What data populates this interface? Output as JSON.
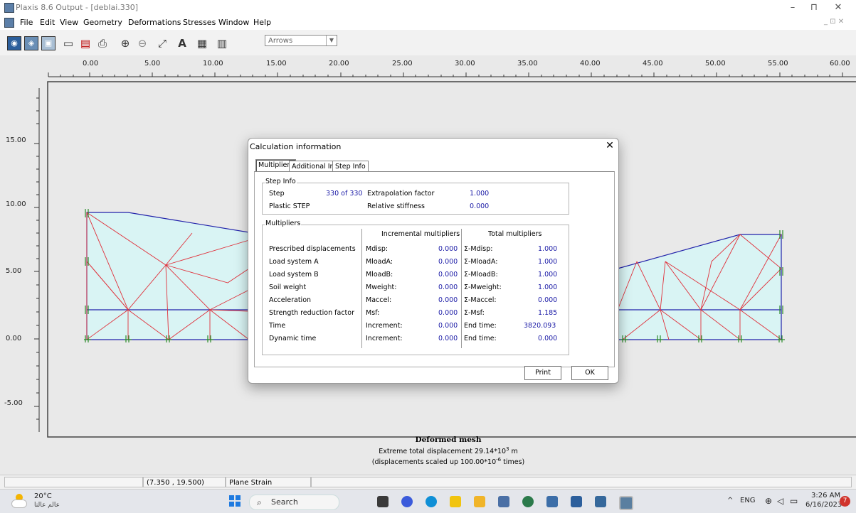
{
  "window": {
    "title": "Plaxis 8.6 Output - [deblai.330]",
    "controls": [
      "–",
      "⊓",
      "✕"
    ],
    "mdi_controls": "_ ⊡ ✕"
  },
  "menu": [
    "File",
    "Edit",
    "View",
    "Geometry",
    "Deformations",
    "Stresses",
    "Window",
    "Help"
  ],
  "toolbar": {
    "select_value": "Arrows",
    "icons": [
      "plaxis-logo-icon",
      "output-icon",
      "input-icon",
      "open-folder-icon",
      "print-preview-icon",
      "print-icon",
      "zoom-in-icon",
      "zoom-out-icon",
      "relocate-icon",
      "annotate-icon",
      "table-icon",
      "clipboard-icon"
    ]
  },
  "ruler": {
    "top_labels": [
      "0.00",
      "5.00",
      "10.00",
      "15.00",
      "20.00",
      "25.00",
      "30.00",
      "35.00",
      "40.00",
      "45.00",
      "50.00",
      "55.00",
      "60.00"
    ],
    "left_labels": [
      "15.00",
      "10.00",
      "5.00",
      "0.00",
      "-5.00"
    ]
  },
  "dialog": {
    "title": "Calculation information",
    "close": "✕",
    "tabs": [
      "Multipliers",
      "Additional Info",
      "Step Info"
    ],
    "step_info": {
      "group_label": "Step Info",
      "step_label": "Step",
      "step_value": "330 of 330",
      "extrapolation_label": "Extrapolation factor",
      "extrapolation_value": "1.000",
      "plastic_label": "Plastic STEP",
      "relative_stiffness_label": "Relative stiffness",
      "relative_stiffness_value": "0.000"
    },
    "multipliers": {
      "group_label": "Multipliers",
      "incremental_header": "Incremental multipliers",
      "total_header": "Total multipliers",
      "rows": [
        {
          "name": "Prescribed displacements",
          "inc_key": "Mdisp:",
          "inc_val": "0.000",
          "tot_key": "Σ-Mdisp:",
          "tot_val": "1.000"
        },
        {
          "name": "Load system A",
          "inc_key": "MloadA:",
          "inc_val": "0.000",
          "tot_key": "Σ-MloadA:",
          "tot_val": "1.000"
        },
        {
          "name": "Load system B",
          "inc_key": "MloadB:",
          "inc_val": "0.000",
          "tot_key": "Σ-MloadB:",
          "tot_val": "1.000"
        },
        {
          "name": "Soil weight",
          "inc_key": "Mweight:",
          "inc_val": "0.000",
          "tot_key": "Σ-Mweight:",
          "tot_val": "1.000"
        },
        {
          "name": "Acceleration",
          "inc_key": "Maccel:",
          "inc_val": "0.000",
          "tot_key": "Σ-Maccel:",
          "tot_val": "0.000"
        },
        {
          "name": "Strength reduction factor",
          "inc_key": "Msf:",
          "inc_val": "0.000",
          "tot_key": "Σ-Msf:",
          "tot_val": "1.185"
        },
        {
          "name": "Time",
          "inc_key": "Increment:",
          "inc_val": "0.000",
          "tot_key": "End time:",
          "tot_val": "3820.093"
        },
        {
          "name": "Dynamic time",
          "inc_key": "Increment:",
          "inc_val": "0.000",
          "tot_key": "End time:",
          "tot_val": "0.000"
        }
      ]
    },
    "print_label": "Print",
    "ok_label": "OK"
  },
  "caption": {
    "title": "Deformed mesh",
    "line1_pre": "Extreme total displacement 29.14*10",
    "line1_exp": "3",
    "line1_post": " m",
    "line2_pre": "(displacements scaled up 100.00*10",
    "line2_exp": "-6",
    "line2_post": " times)"
  },
  "statusbar": {
    "coords": "(7.350 , 19.500)",
    "mode": "Plane Strain"
  },
  "taskbar": {
    "temp": "20°C",
    "weather_text": "عالم عالنا",
    "search": "Search",
    "lang": "ENG",
    "time": "3:26 AM",
    "date": "6/16/2023",
    "notification_count": "7"
  },
  "colors": {
    "mesh_fill": "#d9f4f4",
    "mesh_edge": "#2222aa",
    "mesh_lines": "#e0303a",
    "node_mark": "#2a8a2a",
    "value_blue": "#1a1aa6"
  }
}
